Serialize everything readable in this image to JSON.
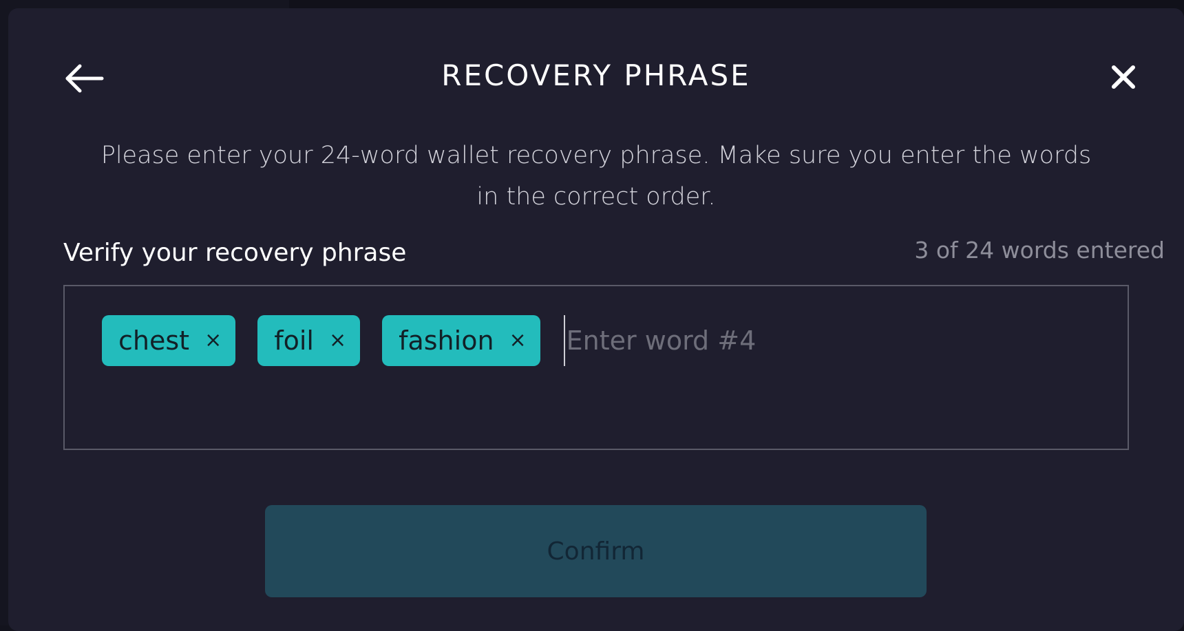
{
  "modal": {
    "title": "RECOVERY PHRASE",
    "instructions": "Please enter your 24-word wallet recovery phrase. Make sure you enter the words in the correct order.",
    "section_label": "Verify your recovery phrase",
    "counter": "3 of 24 words entered",
    "words": [
      "chest",
      "foil",
      "fashion"
    ],
    "remove_glyph": "×",
    "input": {
      "value": "",
      "placeholder": "Enter word #4"
    },
    "confirm_label": "Confirm",
    "icons": {
      "back": "arrow-left-icon",
      "close": "close-icon"
    }
  },
  "colors": {
    "modal_bg": "#1f1e2e",
    "chip_bg": "#23bcbc",
    "confirm_bg": "#22495a",
    "text_primary": "#ffffff",
    "text_muted": "#8e8e9a"
  }
}
